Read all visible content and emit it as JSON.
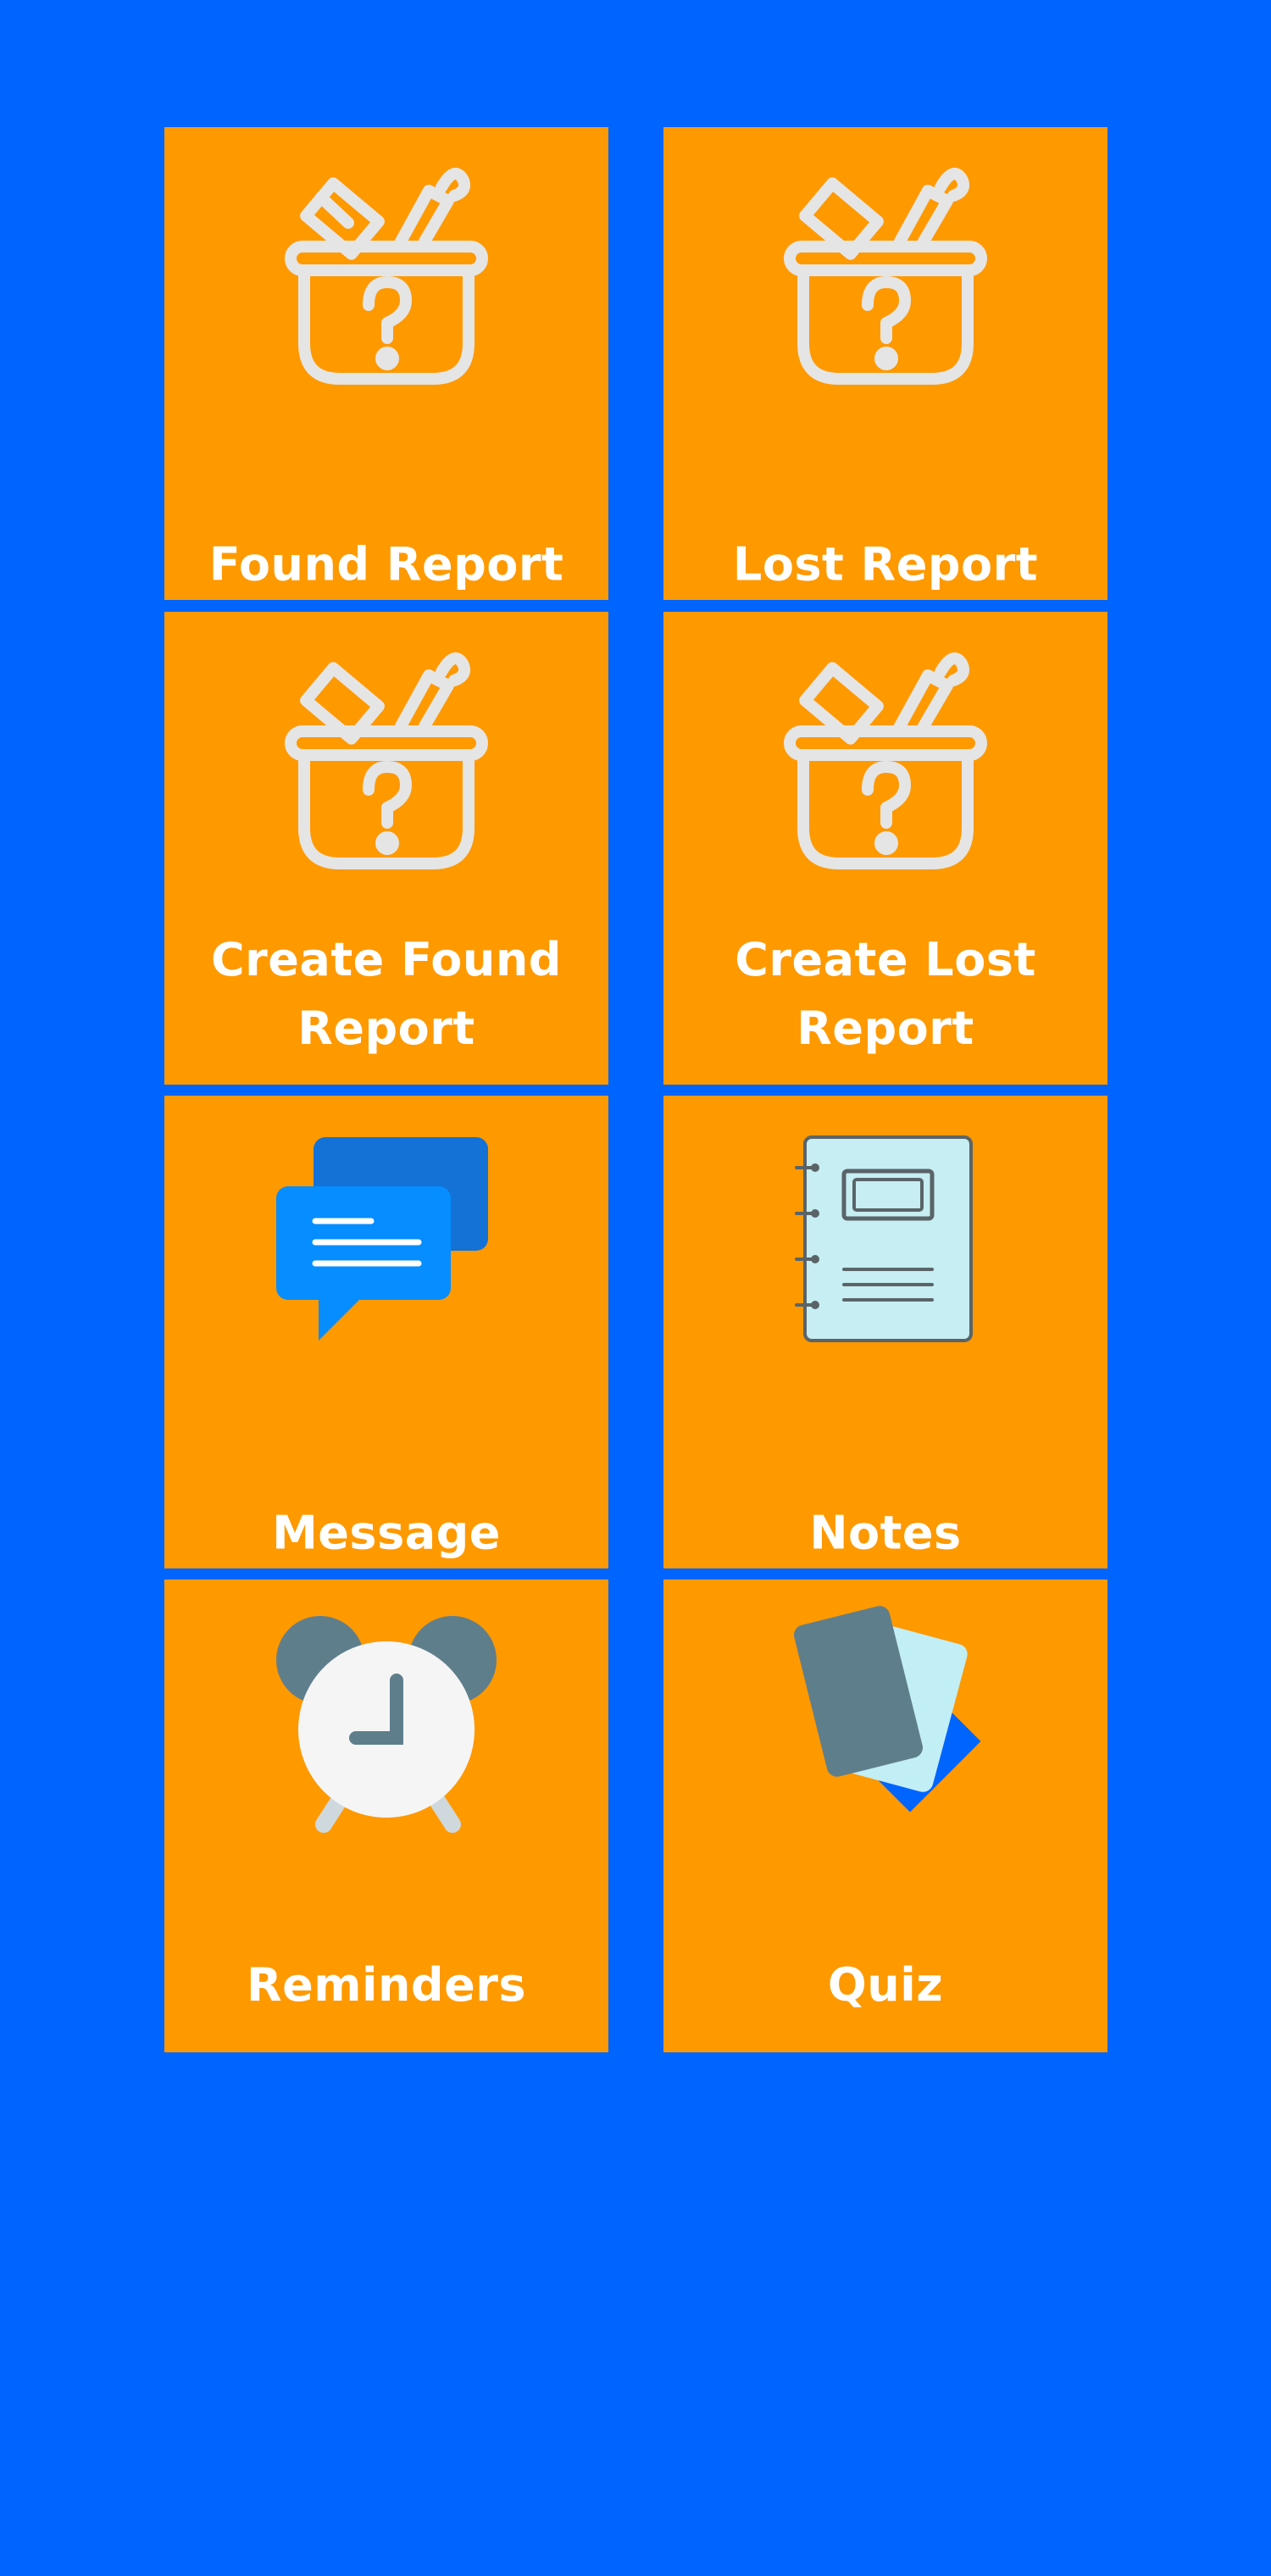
{
  "background_color": "#0064FF",
  "tile_color": "#FF9900",
  "tiles": [
    {
      "label": "Found Report",
      "icon": "lost-and-found-box-icon"
    },
    {
      "label": "Lost Report",
      "icon": "lost-and-found-box-icon"
    },
    {
      "label": "Create Found Report",
      "icon": "lost-and-found-box-icon"
    },
    {
      "label": "Create Lost Report",
      "icon": "lost-and-found-box-icon"
    },
    {
      "label": "Message",
      "icon": "chat-bubbles-icon"
    },
    {
      "label": "Notes",
      "icon": "notebook-icon"
    },
    {
      "label": "Reminders",
      "icon": "alarm-clock-icon"
    },
    {
      "label": "Quiz",
      "icon": "flash-cards-icon"
    }
  ]
}
